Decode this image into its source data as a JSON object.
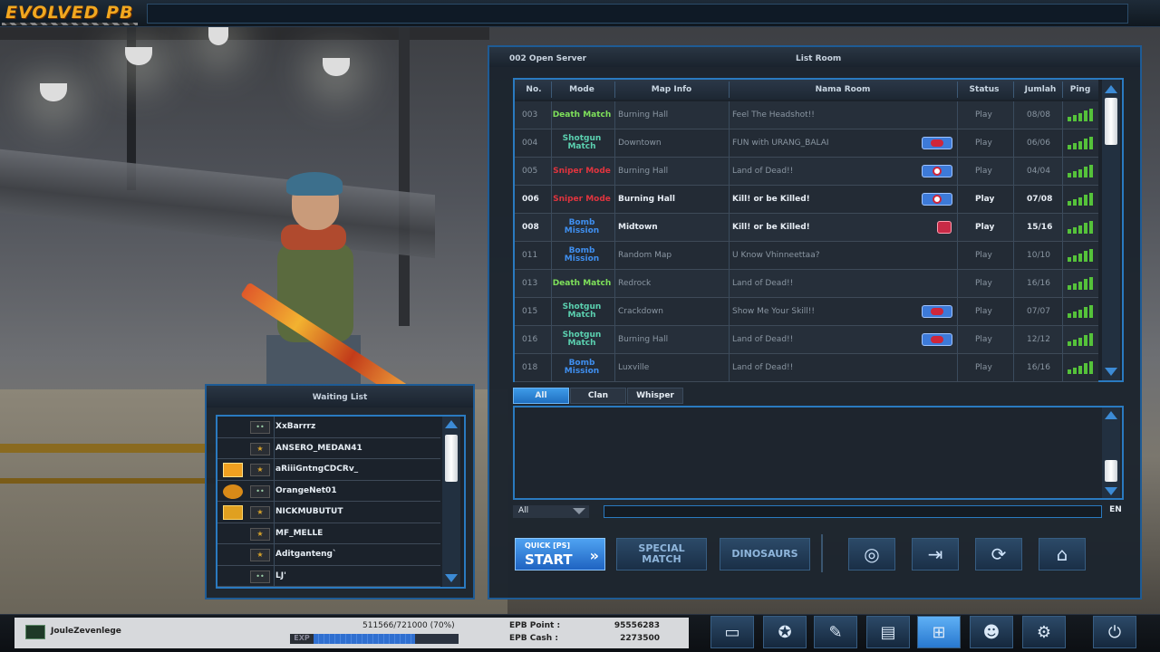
{
  "app": {
    "logo": "EVOLVED PB"
  },
  "list_room": {
    "server": "002 Open Server",
    "title": "List Room",
    "columns": [
      "No.",
      "Mode",
      "Map Info",
      "Nama Room",
      "Status",
      "Jumlah",
      "Ping"
    ],
    "rows": [
      {
        "no": "003",
        "mode": "Death Match",
        "map": "Burning Hall",
        "room": "Feel The Headshot!!",
        "status": "Play",
        "jumlah": "08/08",
        "badge": "none",
        "active": false,
        "mode_color": "#7ee05a"
      },
      {
        "no": "004",
        "mode": "Shotgun Match",
        "map": "Downtown",
        "room": "FUN with URANG_BALAI",
        "status": "Play",
        "jumlah": "06/06",
        "badge": "shotgun",
        "active": false,
        "mode_color": "#5bd1b0"
      },
      {
        "no": "005",
        "mode": "Sniper Mode",
        "map": "Burning Hall",
        "room": "Land of Dead!!",
        "status": "Play",
        "jumlah": "04/04",
        "badge": "sniper",
        "active": false,
        "mode_color": "#e0343e"
      },
      {
        "no": "006",
        "mode": "Sniper Mode",
        "map": "Burning Hall",
        "room": "Kill! or be Killed!",
        "status": "Play",
        "jumlah": "07/08",
        "badge": "sniper",
        "active": true,
        "mode_color": "#e0343e"
      },
      {
        "no": "008",
        "mode": "Bomb Mission",
        "map": "Midtown",
        "room": "Kill! or be Killed!",
        "status": "Play",
        "jumlah": "15/16",
        "badge": "small",
        "active": true,
        "mode_color": "#3f8ff0"
      },
      {
        "no": "011",
        "mode": "Bomb Mission",
        "map": "Random Map",
        "room": "U Know Vhinneettaa?",
        "status": "Play",
        "jumlah": "10/10",
        "badge": "none",
        "active": false,
        "mode_color": "#3f8ff0"
      },
      {
        "no": "013",
        "mode": "Death Match",
        "map": "Redrock",
        "room": "Land of Dead!!",
        "status": "Play",
        "jumlah": "16/16",
        "badge": "none",
        "active": false,
        "mode_color": "#7ee05a"
      },
      {
        "no": "015",
        "mode": "Shotgun Match",
        "map": "Crackdown",
        "room": "Show Me Your Skill!!",
        "status": "Play",
        "jumlah": "07/07",
        "badge": "shotgun",
        "active": false,
        "mode_color": "#5bd1b0"
      },
      {
        "no": "016",
        "mode": "Shotgun Match",
        "map": "Burning Hall",
        "room": "Land of Dead!!",
        "status": "Play",
        "jumlah": "12/12",
        "badge": "shotgun",
        "active": false,
        "mode_color": "#5bd1b0"
      },
      {
        "no": "018",
        "mode": "Bomb Mission",
        "map": "Luxville",
        "room": "Land of Dead!!",
        "status": "Play",
        "jumlah": "16/16",
        "badge": "none",
        "active": false,
        "mode_color": "#3f8ff0"
      }
    ]
  },
  "chat": {
    "tabs": [
      "All",
      "Clan",
      "Whisper"
    ],
    "active_tab": "All",
    "channel": "All",
    "input_value": "",
    "lang": "EN"
  },
  "buttons": {
    "quick_start_small": "QUICK [PS]",
    "quick_start_big": "START",
    "special_match": "SPECIAL MATCH",
    "dinosaurs": "DINOSAURS",
    "icons": [
      "globe-icon",
      "enter-room-icon",
      "refresh-icon",
      "create-room-icon"
    ]
  },
  "waiting_list": {
    "title": "Waiting List",
    "players": [
      {
        "name": "XxBarrrz",
        "badge": "none",
        "rank": "green"
      },
      {
        "name": "ANSERO_MEDAN41",
        "badge": "none",
        "rank": "gold"
      },
      {
        "name": "aRiiiGntngCDCRv_",
        "badge": "diamond",
        "rank": "gold"
      },
      {
        "name": "OrangeNet01",
        "badge": "wings",
        "rank": "green"
      },
      {
        "name": "NICKMUBUTUT",
        "badge": "crown",
        "rank": "gold"
      },
      {
        "name": "MF_MELLE",
        "badge": "none",
        "rank": "gold"
      },
      {
        "name": "Aditganteng`",
        "badge": "none",
        "rank": "gold"
      },
      {
        "name": "LJ'",
        "badge": "none",
        "rank": "green"
      }
    ]
  },
  "profile": {
    "username": "JouleZevenlege",
    "exp_text": "511566/721000 (70%)",
    "exp_label": "EXP",
    "exp_fraction": 0.7,
    "epb_point_label": "EPB Point :",
    "epb_point": "95556283",
    "epb_cash_label": "EPB Cash :",
    "epb_cash": "2273500"
  },
  "nav": [
    "tv-icon",
    "clan-emblem-icon",
    "inventory-icon",
    "shop-icon",
    "lobby-icon",
    "community-icon",
    "settings-icon",
    "power-icon"
  ],
  "colors": {
    "accent": "#2a7ac0",
    "ping": "#55c23a",
    "logo": "#f1a820"
  }
}
